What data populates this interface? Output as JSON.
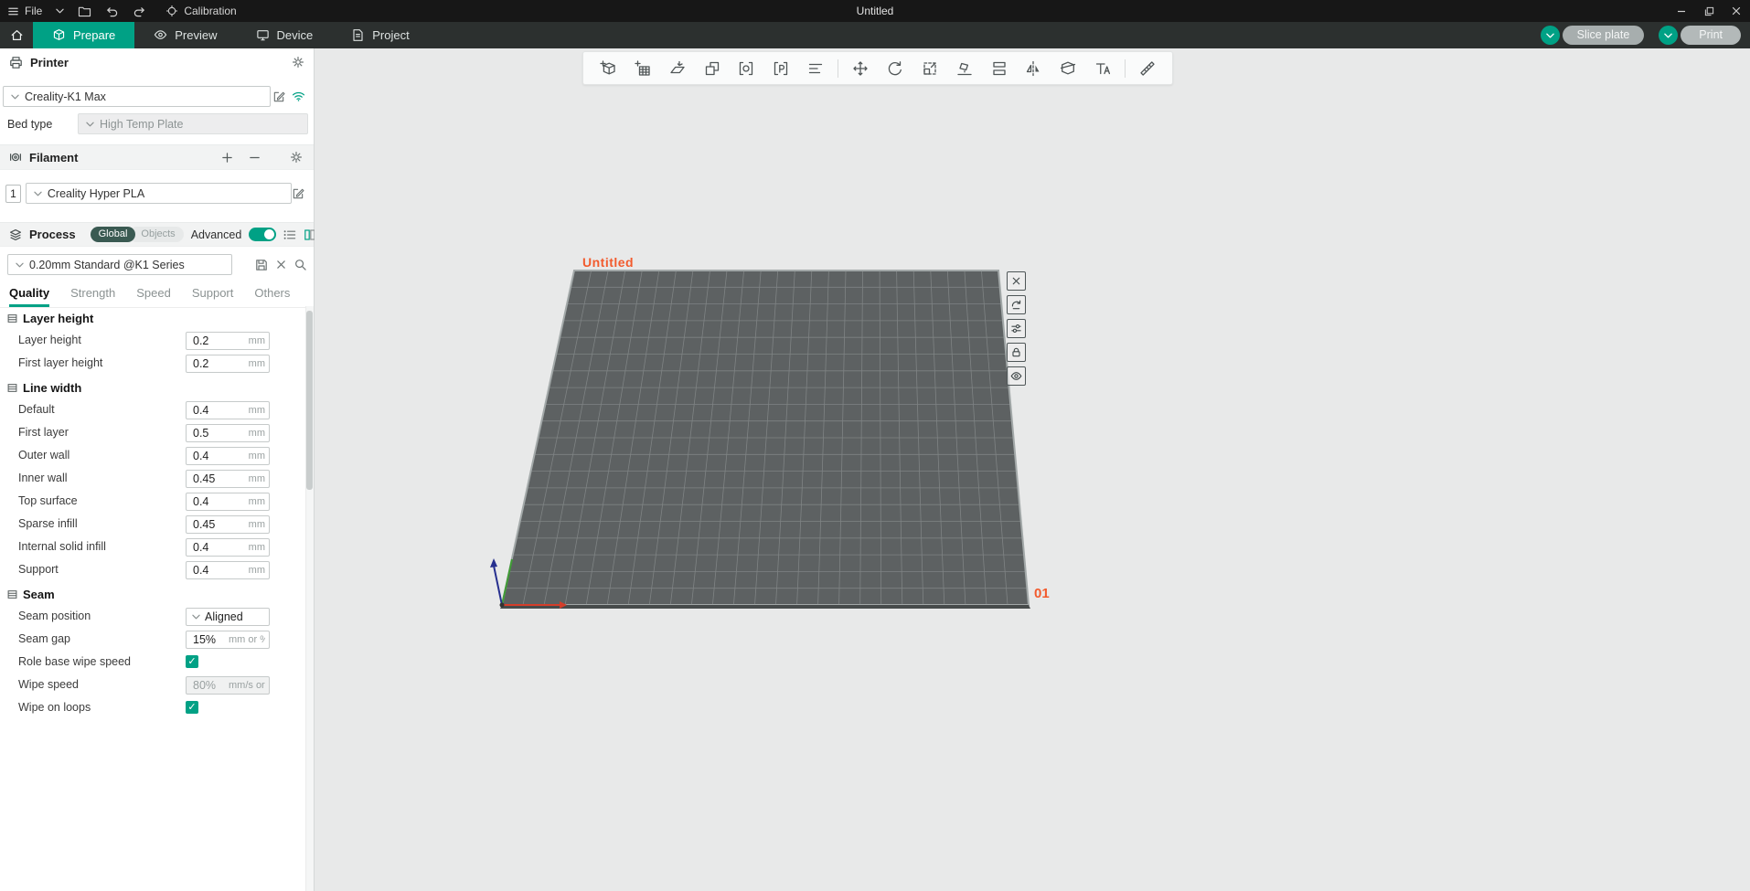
{
  "titlebar": {
    "menu": "File",
    "title": "Untitled",
    "calibration": "Calibration"
  },
  "tabbar": {
    "tabs": [
      "Prepare",
      "Preview",
      "Device",
      "Project"
    ],
    "slice_button": "Slice plate",
    "print_button": "Print"
  },
  "printer": {
    "title": "Printer",
    "model": "Creality-K1 Max",
    "bed_type_label": "Bed type",
    "bed_type": "High Temp Plate"
  },
  "filament": {
    "title": "Filament",
    "slot": "1",
    "material": "Creality Hyper PLA"
  },
  "process": {
    "title": "Process",
    "scopes": [
      "Global",
      "Objects"
    ],
    "advanced_label": "Advanced",
    "preset": "0.20mm Standard @K1 Series",
    "tabs": [
      "Quality",
      "Strength",
      "Speed",
      "Support",
      "Others"
    ],
    "active_tab": "Quality",
    "sections": [
      {
        "title": "Layer height",
        "rows": [
          {
            "type": "input",
            "label": "Layer height",
            "value": "0.2",
            "unit": "mm"
          },
          {
            "type": "input",
            "label": "First layer height",
            "value": "0.2",
            "unit": "mm"
          }
        ]
      },
      {
        "title": "Line width",
        "rows": [
          {
            "type": "input",
            "label": "Default",
            "value": "0.4",
            "unit": "mm"
          },
          {
            "type": "input",
            "label": "First layer",
            "value": "0.5",
            "unit": "mm"
          },
          {
            "type": "input",
            "label": "Outer wall",
            "value": "0.4",
            "unit": "mm"
          },
          {
            "type": "input",
            "label": "Inner wall",
            "value": "0.45",
            "unit": "mm"
          },
          {
            "type": "input",
            "label": "Top surface",
            "value": "0.4",
            "unit": "mm"
          },
          {
            "type": "input",
            "label": "Sparse infill",
            "value": "0.45",
            "unit": "mm"
          },
          {
            "type": "input",
            "label": "Internal solid infill",
            "value": "0.4",
            "unit": "mm"
          },
          {
            "type": "input",
            "label": "Support",
            "value": "0.4",
            "unit": "mm"
          }
        ]
      },
      {
        "title": "Seam",
        "rows": [
          {
            "type": "select",
            "label": "Seam position",
            "value": "Aligned"
          },
          {
            "type": "input",
            "label": "Seam gap",
            "value": "15%",
            "unit": "mm or %"
          },
          {
            "type": "checkbox",
            "label": "Role base wipe speed",
            "checked": true
          },
          {
            "type": "input",
            "label": "Wipe speed",
            "value": "80%",
            "unit": "mm/s or %",
            "disabled": true
          },
          {
            "type": "checkbox",
            "label": "Wipe on loops",
            "checked": true
          }
        ]
      }
    ]
  },
  "viewport": {
    "plate_name": "Untitled",
    "plate_number": "01",
    "toolbar_icons": [
      "add-model",
      "add-plate",
      "lay-on-face",
      "clone",
      "copy",
      "paste",
      "arrange",
      "move",
      "rotate",
      "scale",
      "lay-flat",
      "split",
      "mirror",
      "cut",
      "text",
      "measure"
    ],
    "plate_tool_icons": [
      "delete-plate",
      "orient-plate",
      "plate-settings",
      "lock-plate",
      "plate-visibility"
    ]
  },
  "colors": {
    "accent": "#00a185",
    "plate_label_orange": "#f25b2e"
  }
}
